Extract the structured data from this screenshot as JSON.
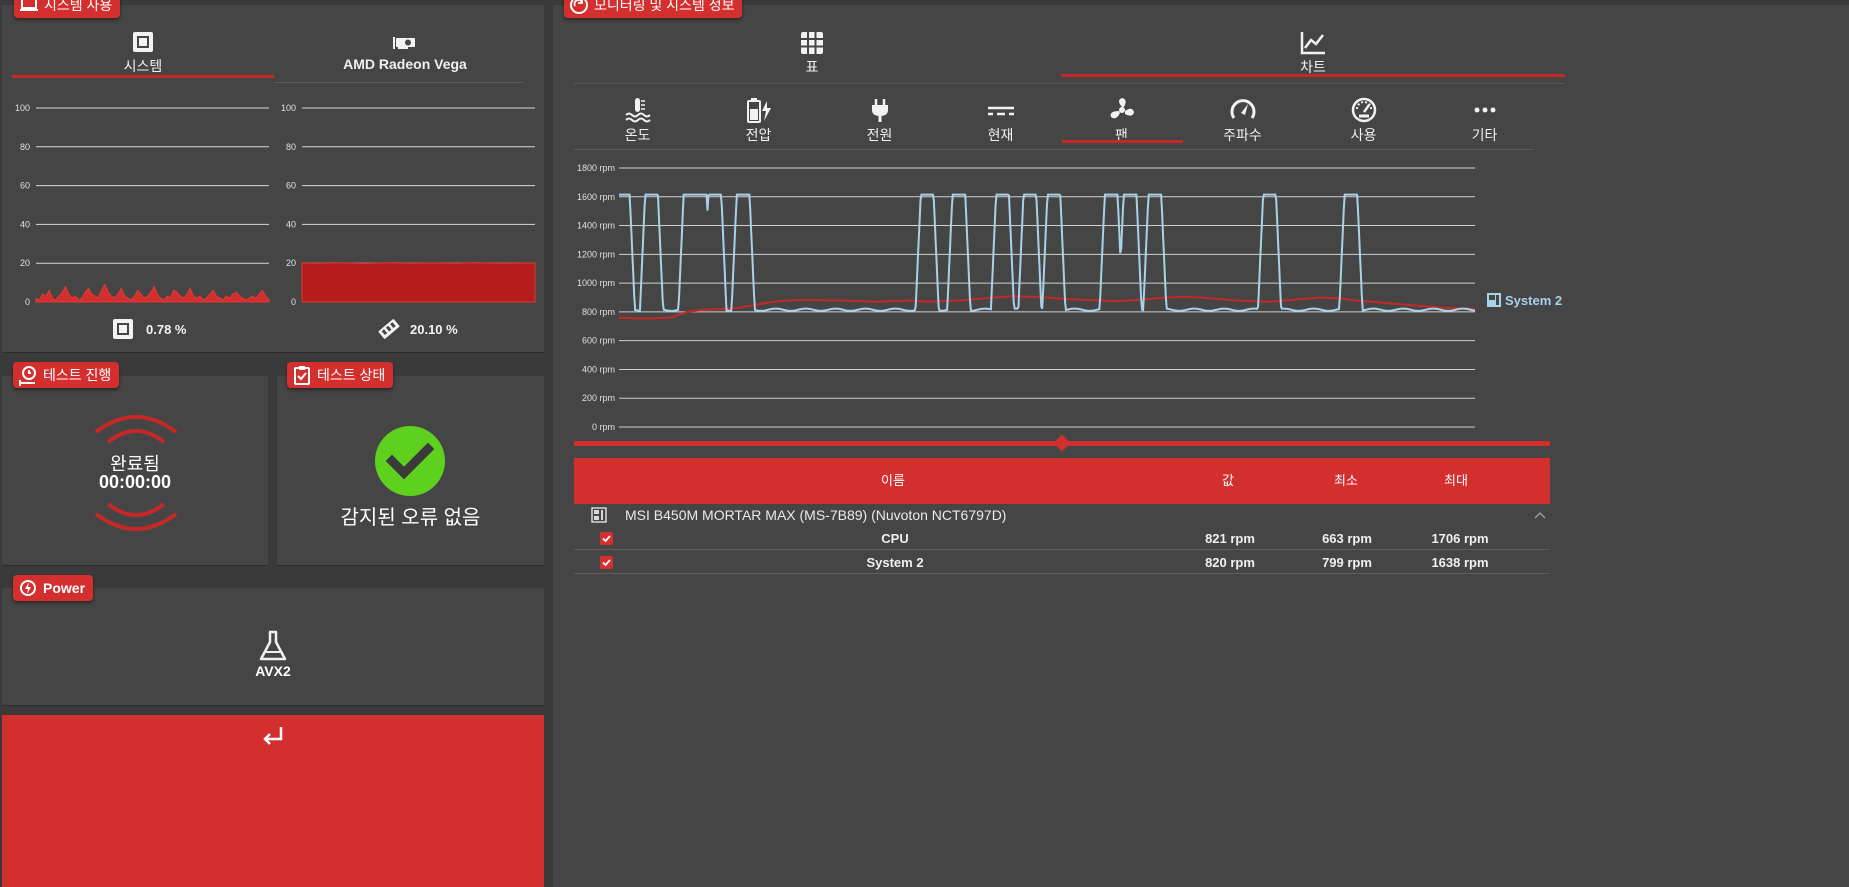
{
  "usage": {
    "badge": "시스템 사용",
    "tabs": [
      {
        "label": "시스템"
      },
      {
        "label": "AMD Radeon Vega"
      }
    ],
    "y_ticks": [
      "100",
      "80",
      "60",
      "40",
      "20",
      "0"
    ],
    "cpu_value": "0.78 %",
    "gpu_value": "20.10 %"
  },
  "progress": {
    "badge": "테스트 진행",
    "status": "완료됨",
    "time": "00:00:00"
  },
  "test_status": {
    "badge": "테스트 상태",
    "message": "감지된 오류 없음"
  },
  "power": {
    "badge": "Power",
    "mode": "AVX2"
  },
  "monitor": {
    "badge": "모니터링 및 시스템 정보",
    "view_tabs": [
      {
        "label": "표"
      },
      {
        "label": "차트"
      }
    ],
    "sensor_tabs": [
      {
        "label": "온도"
      },
      {
        "label": "전압"
      },
      {
        "label": "전원"
      },
      {
        "label": "현재"
      },
      {
        "label": "팬"
      },
      {
        "label": "주파수"
      },
      {
        "label": "사용"
      },
      {
        "label": "기타"
      }
    ],
    "chart_legend": "System 2",
    "table": {
      "headers": {
        "name": "이름",
        "value": "값",
        "min": "최소",
        "max": "최대"
      },
      "device": "MSI B450M MORTAR MAX (MS-7B89) (Nuvoton NCT6797D)",
      "rows": [
        {
          "name": "CPU",
          "value": "821 rpm",
          "min": "663 rpm",
          "max": "1706 rpm"
        },
        {
          "name": "System 2",
          "value": "820 rpm",
          "min": "799 rpm",
          "max": "1638 rpm"
        }
      ]
    }
  },
  "chart_data": [
    {
      "type": "area",
      "series": [
        {
          "values": [
            2,
            1,
            4,
            3,
            6,
            2,
            1,
            3,
            5,
            8,
            4,
            2,
            3,
            1,
            2,
            5,
            7,
            4,
            3,
            2,
            6,
            9,
            5,
            3,
            2,
            4,
            7,
            3,
            2,
            1,
            3,
            6,
            4,
            2,
            3,
            5,
            8,
            4,
            2,
            1,
            3,
            2,
            6,
            5,
            3,
            2,
            4,
            7,
            3,
            2,
            3,
            1,
            2,
            4,
            6,
            3,
            2,
            1,
            3,
            2,
            4,
            5,
            3,
            2,
            1,
            2,
            3,
            2,
            4,
            6,
            3,
            1
          ]
        }
      ],
      "ylim": [
        0,
        100
      ],
      "y_ticks": [
        0,
        20,
        40,
        60,
        80,
        100
      ]
    },
    {
      "type": "area",
      "series": [
        {
          "values": [
            20.1,
            20.0,
            20.2,
            20.1,
            19.9,
            20.1,
            20.2,
            20.0,
            20.1,
            20.1,
            20.0,
            20.2,
            20.1,
            20.0,
            20.1,
            20.1
          ]
        }
      ],
      "ylim": [
        0,
        100
      ],
      "y_ticks": [
        0,
        20,
        40,
        60,
        80,
        100
      ]
    },
    {
      "type": "line",
      "y_ticks": [
        "1800 rpm",
        "1600 rpm",
        "1400 rpm",
        "1200 rpm",
        "1000 rpm",
        "800 rpm",
        "600 rpm",
        "400 rpm",
        "200 rpm",
        "0 rpm"
      ],
      "ylim": [
        0,
        1800
      ],
      "series": [
        {
          "name": "System 2",
          "color": "#c62828",
          "values": [
            760,
            755,
            755,
            760,
            800,
            815,
            820,
            830,
            850,
            870,
            880,
            885,
            880,
            880,
            875,
            870,
            875,
            880,
            870,
            875,
            880,
            890,
            900,
            910,
            905,
            900,
            890,
            885,
            880,
            875,
            880,
            890,
            900,
            905,
            900,
            890,
            880,
            875,
            870,
            880,
            890,
            900,
            895,
            880,
            870,
            860,
            850,
            840,
            830,
            825,
            820
          ]
        },
        {
          "name": "CPU",
          "color": "#a9d1e8",
          "pulses": [
            0.005,
            0.038,
            0.083,
            0.095,
            0.112,
            0.145,
            0.36,
            0.397,
            0.448,
            0.48,
            0.508,
            0.575,
            0.597,
            0.626,
            0.76,
            0.855
          ]
        }
      ]
    }
  ]
}
